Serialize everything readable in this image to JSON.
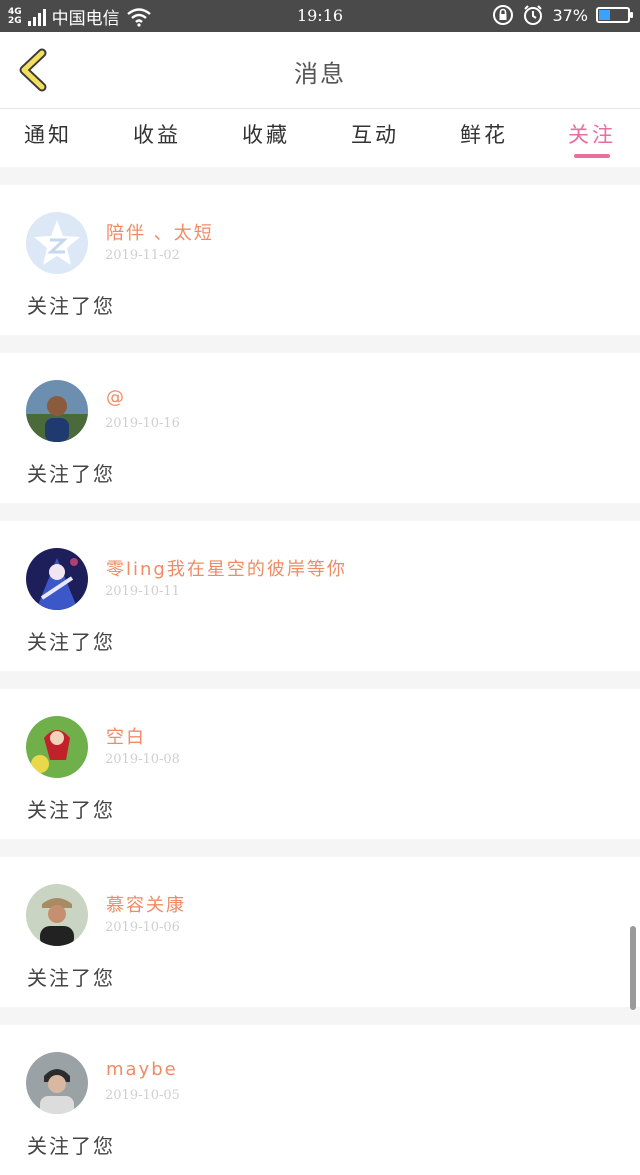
{
  "status_bar": {
    "network_top": "4G",
    "network_bottom": "2G",
    "carrier": "中国电信",
    "time": "19:16",
    "battery_percent": "37%",
    "battery_level": 0.37,
    "icons": [
      "signal-icon",
      "wifi-icon",
      "lock-rotation-icon",
      "alarm-icon",
      "battery-icon"
    ]
  },
  "header": {
    "title": "消息",
    "back_icon": "back-chevron-icon"
  },
  "tabs": [
    {
      "label": "通知",
      "active": false
    },
    {
      "label": "收益",
      "active": false
    },
    {
      "label": "收藏",
      "active": false
    },
    {
      "label": "互动",
      "active": false
    },
    {
      "label": "鲜花",
      "active": false
    },
    {
      "label": "关注",
      "active": true
    }
  ],
  "colors": {
    "accent": "#e96e9e",
    "name": "#f08b66",
    "status_bar": "#4a4a4a"
  },
  "items": [
    {
      "name": "陪伴 、太短",
      "date": "2019-11-02",
      "message": "关注了您",
      "avatar": "default-qzone-avatar"
    },
    {
      "name": "@",
      "date": "2019-10-16",
      "message": "关注了您",
      "avatar": "photo-man-outdoors"
    },
    {
      "name": "零ling我在星空的彼岸等你",
      "date": "2019-10-11",
      "message": "关注了您",
      "avatar": "anime-illustration"
    },
    {
      "name": "空白",
      "date": "2019-10-08",
      "message": "关注了您",
      "avatar": "anime-girl-green"
    },
    {
      "name": "慕容关康",
      "date": "2019-10-06",
      "message": "关注了您",
      "avatar": "photo-man-hat"
    },
    {
      "name": "maybe",
      "date": "2019-10-05",
      "message": "关注了您",
      "avatar": "photo-young-man"
    }
  ]
}
